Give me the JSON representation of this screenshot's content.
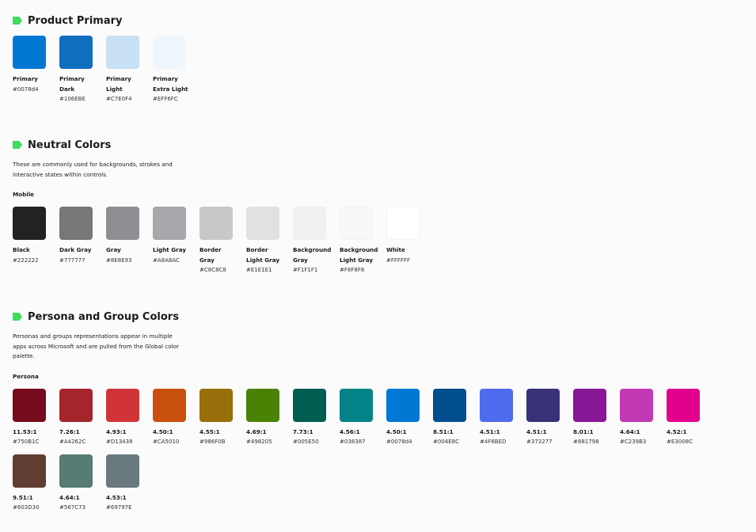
{
  "product": {
    "title": "Product Primary",
    "swatches": [
      {
        "line1": "Primary",
        "line2": "",
        "hex": "#0078d4",
        "color": "#0078d4"
      },
      {
        "line1": "Primary",
        "line2": "Dark",
        "hex": "#106EBE",
        "color": "#106EBE"
      },
      {
        "line1": "Primary",
        "line2": "Light",
        "hex": "#C7E0F4",
        "color": "#C7E0F4"
      },
      {
        "line1": "Primary",
        "line2": "Extra Light",
        "hex": "#EFF6FC",
        "color": "#EFF6FC"
      }
    ]
  },
  "neutral": {
    "title": "Neutral Colors",
    "description": "These are commonly used for backgrounds, strokes and interactive states within controls.",
    "subheading": "Mobile",
    "swatches": [
      {
        "line1": "Black",
        "line2": "",
        "hex": "#222222",
        "color": "#222222"
      },
      {
        "line1": "Dark Gray",
        "line2": "",
        "hex": "#777777",
        "color": "#777777"
      },
      {
        "line1": "Gray",
        "line2": "",
        "hex": "#8E8E93",
        "color": "#8E8E93"
      },
      {
        "line1": "Light Gray",
        "line2": "",
        "hex": "#A8A8AC",
        "color": "#A8A8AC"
      },
      {
        "line1": "Border",
        "line2": "Gray",
        "hex": "#C8C8C8",
        "color": "#C8C8C8"
      },
      {
        "line1": "Border",
        "line2": "Light Gray",
        "hex": "#E1E1E1",
        "color": "#E1E1E1"
      },
      {
        "line1": "Background",
        "line2": "Gray",
        "hex": "#F1F1F1",
        "color": "#F1F1F1"
      },
      {
        "line1": "Background",
        "line2": "Light Gray",
        "hex": "#F8F8F8",
        "color": "#F8F8F8"
      },
      {
        "line1": "White",
        "line2": "",
        "hex": "#FFFFFF",
        "color": "#FFFFFF"
      }
    ]
  },
  "persona": {
    "title": "Persona and Group Colors",
    "description": "Personas and groups representations appear in multiple apps across Microsoft and are pulled from the Global color palette.",
    "subheading": "Persona",
    "swatches": [
      {
        "line1": "11.53:1",
        "line2": "",
        "hex": "#750B1C",
        "color": "#750B1C"
      },
      {
        "line1": "7.26:1",
        "line2": "",
        "hex": "#A4262C",
        "color": "#A4262C"
      },
      {
        "line1": "4.93:1",
        "line2": "",
        "hex": "#D13438",
        "color": "#D13438"
      },
      {
        "line1": "4.50:1",
        "line2": "",
        "hex": "#CA5010",
        "color": "#CA5010"
      },
      {
        "line1": "4.55:1",
        "line2": "",
        "hex": "#986F0B",
        "color": "#986F0B"
      },
      {
        "line1": "4.69:1",
        "line2": "",
        "hex": "#498205",
        "color": "#498205"
      },
      {
        "line1": "7.73:1",
        "line2": "",
        "hex": "#005E50",
        "color": "#005E50"
      },
      {
        "line1": "4.56:1",
        "line2": "",
        "hex": "#038387",
        "color": "#038387"
      },
      {
        "line1": "4.50:1",
        "line2": "",
        "hex": "#0078d4",
        "color": "#0078d4"
      },
      {
        "line1": "8.51:1",
        "line2": "",
        "hex": "#004E8C",
        "color": "#004E8C"
      },
      {
        "line1": "4.51:1",
        "line2": "",
        "hex": "#4F6BED",
        "color": "#4F6BED"
      },
      {
        "line1": "4.51:1",
        "line2": "",
        "hex": "#373277",
        "color": "#373277"
      },
      {
        "line1": "8.01:1",
        "line2": "",
        "hex": "#881798",
        "color": "#881798"
      },
      {
        "line1": "4.64:1",
        "line2": "",
        "hex": "#C239B3",
        "color": "#C239B3"
      },
      {
        "line1": "4.52:1",
        "line2": "",
        "hex": "#E3008C",
        "color": "#E3008C"
      },
      {
        "line1": "9.51:1",
        "line2": "",
        "hex": "#603D30",
        "color": "#603D30"
      },
      {
        "line1": "4.64:1",
        "line2": "",
        "hex": "#567C73",
        "color": "#567C73"
      },
      {
        "line1": "4.53:1",
        "line2": "",
        "hex": "#69797E",
        "color": "#69797E"
      }
    ]
  }
}
